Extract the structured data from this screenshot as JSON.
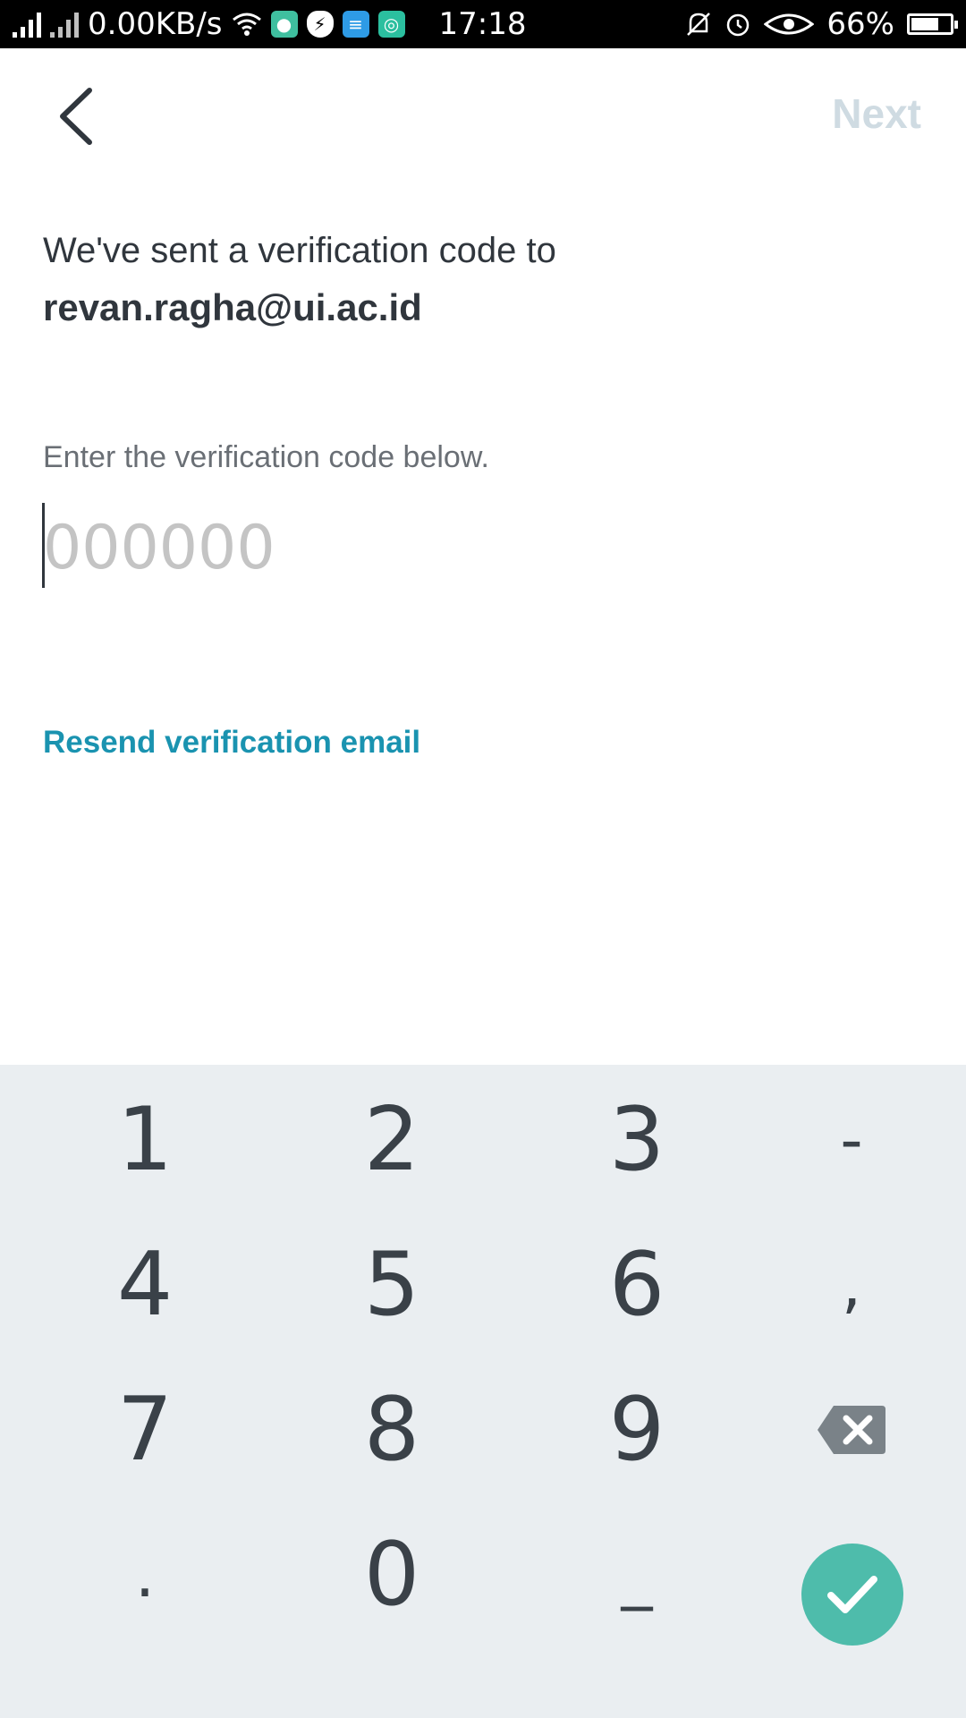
{
  "status_bar": {
    "network_speed": "0.00KB/s",
    "time": "17:18",
    "battery_percent": "66%",
    "battery_level": 0.66
  },
  "header": {
    "next_label": "Next"
  },
  "content": {
    "sent_message": "We've sent a verification code to",
    "email": "revan.ragha@ui.ac.id",
    "enter_label": "Enter the verification code below.",
    "code_placeholder": "000000",
    "resend_label": "Resend verification email"
  },
  "keypad": {
    "keys": [
      "1",
      "2",
      "3",
      "-",
      "4",
      "5",
      "6",
      ",",
      "7",
      "8",
      "9",
      ".",
      "0",
      "_"
    ]
  },
  "colors": {
    "accent": "#1a93b0",
    "confirm": "#4ebcab",
    "next_disabled": "#cfdbe2",
    "keypad_bg": "#eaeef1"
  }
}
